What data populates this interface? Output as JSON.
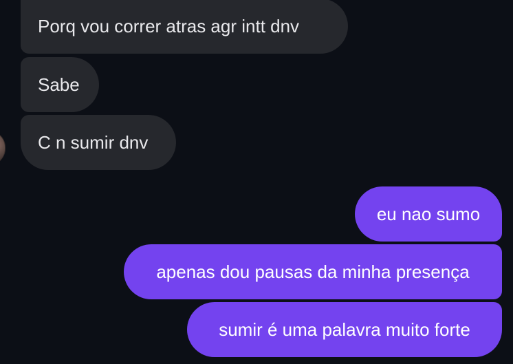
{
  "messages": {
    "incoming": [
      {
        "text": "Porq vou correr atras agr intt dnv"
      },
      {
        "text": "Sabe"
      },
      {
        "text": "C n sumir dnv"
      }
    ],
    "outgoing": [
      {
        "text": "eu nao sumo"
      },
      {
        "text": "apenas dou pausas da minha presença"
      },
      {
        "text": "sumir é uma palavra muito forte"
      }
    ]
  },
  "colors": {
    "background": "#0c0f16",
    "incoming_bubble": "#26282d",
    "outgoing_bubble": "#7443ef"
  }
}
